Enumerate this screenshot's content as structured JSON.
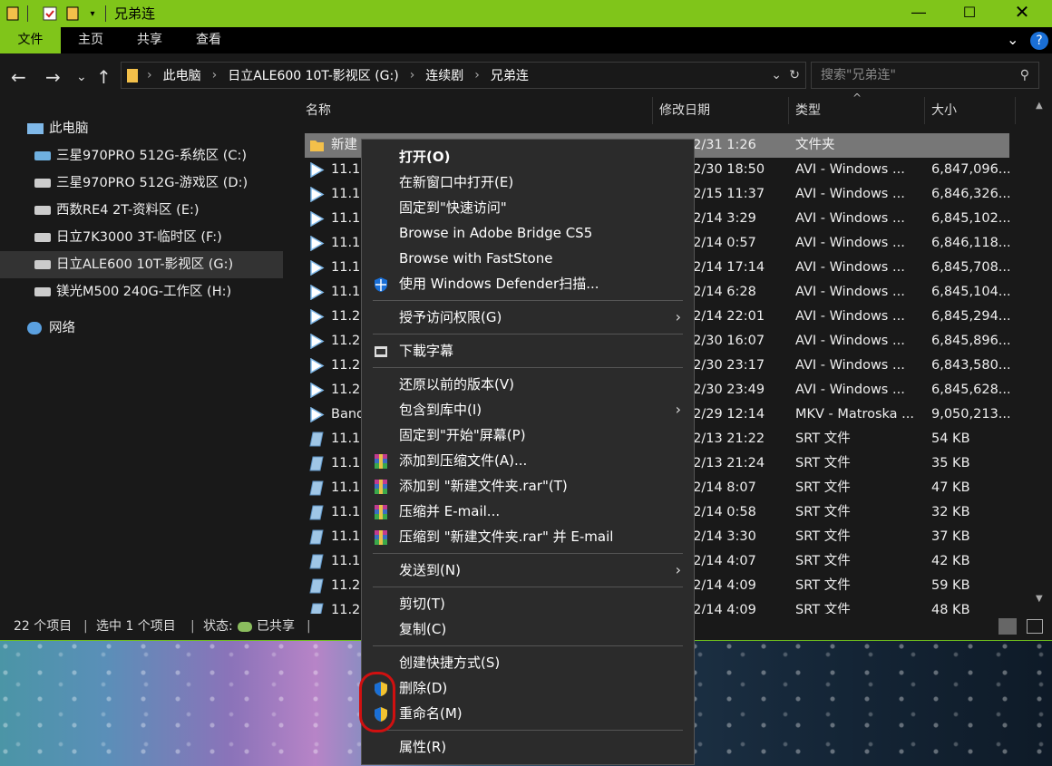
{
  "title": "兄弟连",
  "ribbon": {
    "tabs": [
      "文件",
      "主页",
      "共享",
      "查看"
    ]
  },
  "path": [
    "此电脑",
    "日立ALE600 10T-影视区 (G:)",
    "连续剧",
    "兄弟连"
  ],
  "search": {
    "placeholder": "搜索\"兄弟连\""
  },
  "nav": {
    "this_pc": "此电脑",
    "drives": [
      "三星970PRO 512G-系统区 (C:)",
      "三星970PRO 512G-游戏区 (D:)",
      "西数RE4 2T-资料区 (E:)",
      "日立7K3000 3T-临时区 (F:)",
      "日立ALE600 10T-影视区 (G:)",
      "镁光M500 240G-工作区 (H:)"
    ],
    "network": "网络"
  },
  "columns": {
    "name": "名称",
    "date": "修改日期",
    "type": "类型",
    "size": "大小"
  },
  "files": [
    {
      "name": "新建",
      "date": "/12/31 1:26",
      "type": "文件夹",
      "size": "",
      "icon": "folder"
    },
    {
      "name": "11.1",
      "date": "/12/30 18:50",
      "type": "AVI - Windows ...",
      "size": "6,847,096...",
      "icon": "video"
    },
    {
      "name": "11.1",
      "date": "/12/15 11:37",
      "type": "AVI - Windows ...",
      "size": "6,846,326...",
      "icon": "video"
    },
    {
      "name": "11.1",
      "date": "/12/14 3:29",
      "type": "AVI - Windows ...",
      "size": "6,845,102...",
      "icon": "video"
    },
    {
      "name": "11.1",
      "date": "/12/14 0:57",
      "type": "AVI - Windows ...",
      "size": "6,846,118...",
      "icon": "video"
    },
    {
      "name": "11.1",
      "date": "/12/14 17:14",
      "type": "AVI - Windows ...",
      "size": "6,845,708...",
      "icon": "video"
    },
    {
      "name": "11.1",
      "date": "/12/14 6:28",
      "type": "AVI - Windows ...",
      "size": "6,845,104...",
      "icon": "video"
    },
    {
      "name": "11.2",
      "date": "/12/14 22:01",
      "type": "AVI - Windows ...",
      "size": "6,845,294...",
      "icon": "video"
    },
    {
      "name": "11.2",
      "date": "/12/30 16:07",
      "type": "AVI - Windows ...",
      "size": "6,845,896...",
      "icon": "video"
    },
    {
      "name": "11.2",
      "date": "/12/30 23:17",
      "type": "AVI - Windows ...",
      "size": "6,843,580...",
      "icon": "video"
    },
    {
      "name": "11.2",
      "date": "/12/30 23:49",
      "type": "AVI - Windows ...",
      "size": "6,845,628...",
      "icon": "video"
    },
    {
      "name": "Band",
      "date": "/12/29 12:14",
      "type": "MKV - Matroska ...",
      "size": "9,050,213...",
      "icon": "video"
    },
    {
      "name": "11.1",
      "date": "/12/13 21:22",
      "type": "SRT 文件",
      "size": "54 KB",
      "icon": "srt"
    },
    {
      "name": "11.1",
      "date": "/12/13 21:24",
      "type": "SRT 文件",
      "size": "35 KB",
      "icon": "srt"
    },
    {
      "name": "11.1",
      "date": "/12/14 8:07",
      "type": "SRT 文件",
      "size": "47 KB",
      "icon": "srt"
    },
    {
      "name": "11.1",
      "date": "/12/14 0:58",
      "type": "SRT 文件",
      "size": "32 KB",
      "icon": "srt"
    },
    {
      "name": "11.1",
      "date": "/12/14 3:30",
      "type": "SRT 文件",
      "size": "37 KB",
      "icon": "srt"
    },
    {
      "name": "11.1",
      "date": "/12/14 4:07",
      "type": "SRT 文件",
      "size": "42 KB",
      "icon": "srt"
    },
    {
      "name": "11.2",
      "date": "/12/14 4:09",
      "type": "SRT 文件",
      "size": "59 KB",
      "icon": "srt"
    },
    {
      "name": "11.2",
      "date": "/12/14 4:09",
      "type": "SRT 文件",
      "size": "48 KB",
      "icon": "srt"
    }
  ],
  "status": {
    "count": "22 个项目",
    "selected": "选中 1 个项目",
    "state": "状态:",
    "shared": "已共享"
  },
  "context_menu": {
    "groups": [
      [
        {
          "label": "打开(O)",
          "icon": "",
          "bold": true
        },
        {
          "label": "在新窗口中打开(E)",
          "icon": ""
        },
        {
          "label": "固定到\"快速访问\"",
          "icon": ""
        },
        {
          "label": "Browse in Adobe Bridge CS5",
          "icon": ""
        },
        {
          "label": "Browse with FastStone",
          "icon": ""
        },
        {
          "label": "使用 Windows Defender扫描...",
          "icon": "defender-shield-icon"
        }
      ],
      [
        {
          "label": "授予访问权限(G)",
          "icon": "",
          "submenu": true
        }
      ],
      [
        {
          "label": "下載字幕",
          "icon": "subtitle-icon"
        }
      ],
      [
        {
          "label": "还原以前的版本(V)",
          "icon": ""
        },
        {
          "label": "包含到库中(I)",
          "icon": "",
          "submenu": true
        },
        {
          "label": "固定到\"开始\"屏幕(P)",
          "icon": ""
        },
        {
          "label": "添加到压缩文件(A)...",
          "icon": "winrar-icon"
        },
        {
          "label": "添加到 \"新建文件夹.rar\"(T)",
          "icon": "winrar-icon"
        },
        {
          "label": "压缩并 E-mail...",
          "icon": "winrar-icon"
        },
        {
          "label": "压缩到 \"新建文件夹.rar\" 并 E-mail",
          "icon": "winrar-icon"
        }
      ],
      [
        {
          "label": "发送到(N)",
          "icon": "",
          "submenu": true
        }
      ],
      [
        {
          "label": "剪切(T)",
          "icon": ""
        },
        {
          "label": "复制(C)",
          "icon": ""
        }
      ],
      [
        {
          "label": "创建快捷方式(S)",
          "icon": ""
        },
        {
          "label": "删除(D)",
          "icon": "uac-shield-icon"
        },
        {
          "label": "重命名(M)",
          "icon": "uac-shield-icon"
        }
      ],
      [
        {
          "label": "属性(R)",
          "icon": ""
        }
      ]
    ]
  },
  "colors": {
    "accent": "#80c51a",
    "annotation": "#d01010"
  }
}
